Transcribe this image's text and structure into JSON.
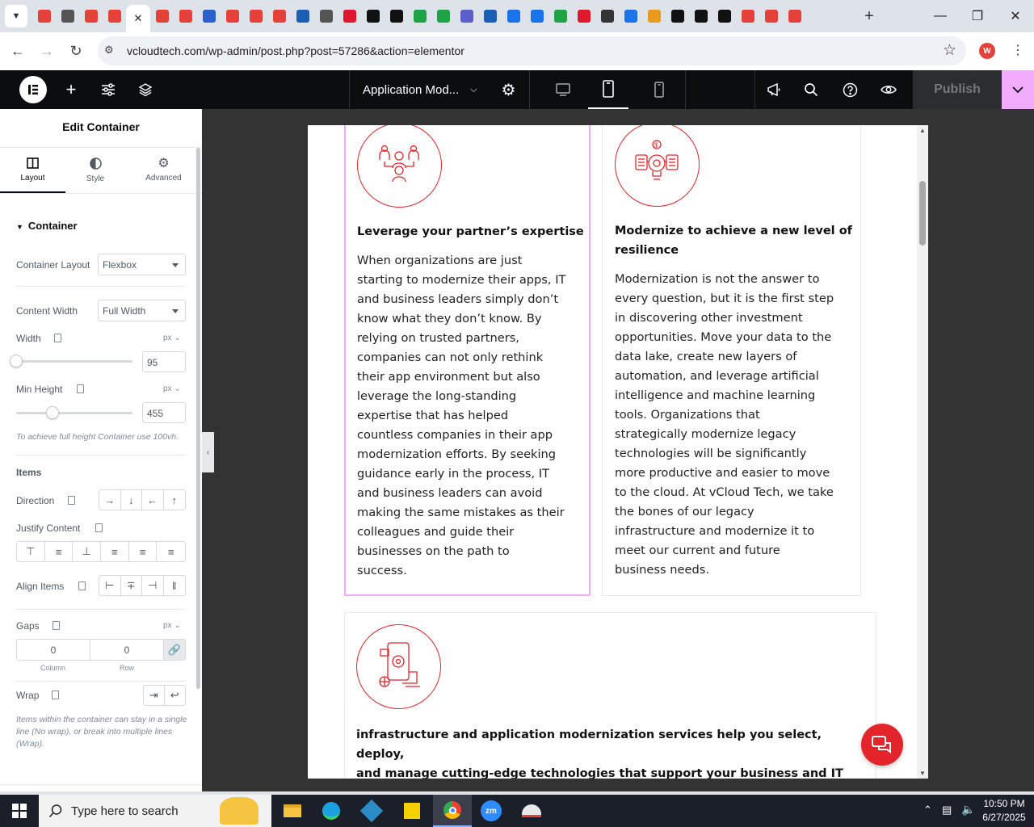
{
  "browser": {
    "url": "vcloudtech.com/wp-admin/post.php?post=57286&action=elementor",
    "tab_favicons": [
      "#e4413a",
      "#555",
      "#e4413a",
      "#e4413a",
      "#e4413a",
      "#e4413a",
      "#e4413a",
      "#2b5fc9",
      "#e4413a",
      "#e4413a",
      "#e4413a",
      "#1a5fb4",
      "#555",
      "#e0182d",
      "#111",
      "#111",
      "#1ea446",
      "#1ea446",
      "#5b5fc7",
      "#1a5fb4",
      "#1a73e8",
      "#1a73e8",
      "#1ea446",
      "#e0182d",
      "#333",
      "#1a73e8",
      "#e89b1a",
      "#111",
      "#111",
      "#111",
      "#e4413a",
      "#e4413a",
      "#e4413a"
    ],
    "profile_initial": "W"
  },
  "elementor": {
    "page_title": "Application Mod...",
    "publish_label": "Publish"
  },
  "panel": {
    "title": "Edit Container",
    "tabs": [
      {
        "label": "Layout"
      },
      {
        "label": "Style"
      },
      {
        "label": "Advanced"
      }
    ],
    "section": "Container",
    "container_layout_label": "Container Layout",
    "container_layout_value": "Flexbox",
    "content_width_label": "Content Width",
    "content_width_value": "Full Width",
    "width_label": "Width",
    "width_unit": "px",
    "width_value": "95",
    "width_slider": 0.0,
    "min_height_label": "Min Height",
    "min_height_unit": "px",
    "min_height_value": "455",
    "min_height_slider": 0.31,
    "min_height_hint": "To achieve full height Container use 100vh.",
    "items_heading": "Items",
    "direction_label": "Direction",
    "justify_label": "Justify Content",
    "align_label": "Align Items",
    "gaps_label": "Gaps",
    "gaps_unit": "px",
    "gap_column": "0",
    "gap_row": "0",
    "gap_column_label": "Column",
    "gap_row_label": "Row",
    "wrap_label": "Wrap",
    "wrap_hint": "Items within the container can stay in a single line (No wrap), or break into multiple lines (Wrap)."
  },
  "content": {
    "card1_title": "Leverage your partner’s expertise",
    "card1_lines": [
      "When organizations are just",
      "starting to modernize their apps, IT",
      "and business leaders simply don’t",
      "know what they don’t know. By",
      "relying on trusted partners,",
      "companies can not only rethink",
      "their app environment but also",
      "leverage the long-standing",
      "expertise that has helped",
      "countless companies in their app",
      "modernization efforts. By seeking",
      "guidance early in the process, IT",
      "and business leaders can avoid",
      "making the same mistakes as their",
      "colleagues and guide their",
      "businesses on the path to",
      "success."
    ],
    "card2_title_lines": [
      "Modernize to achieve a new level of",
      "resilience"
    ],
    "card2_lines": [
      "Modernization is not the answer to",
      "every question, but it is the first step",
      "in discovering other investment",
      "opportunities. Move your data to the",
      "data lake, create new layers of",
      "automation, and leverage artificial",
      "intelligence and machine learning",
      "tools. Organizations that",
      "strategically modernize legacy",
      "technologies will be significantly",
      "more productive and easier to move",
      "to the cloud. At vCloud Tech, we take",
      "the bones of our legacy",
      "infrastructure and modernize it to",
      "meet our current and future",
      "business needs."
    ],
    "card3_title_lines": [
      "infrastructure and application modernization services help you select, deploy,",
      "and manage cutting-edge technologies that support your business and IT needs"
    ]
  },
  "taskbar": {
    "search_placeholder": "Type here to search",
    "time": "10:50 PM",
    "date": "6/27/2025"
  }
}
